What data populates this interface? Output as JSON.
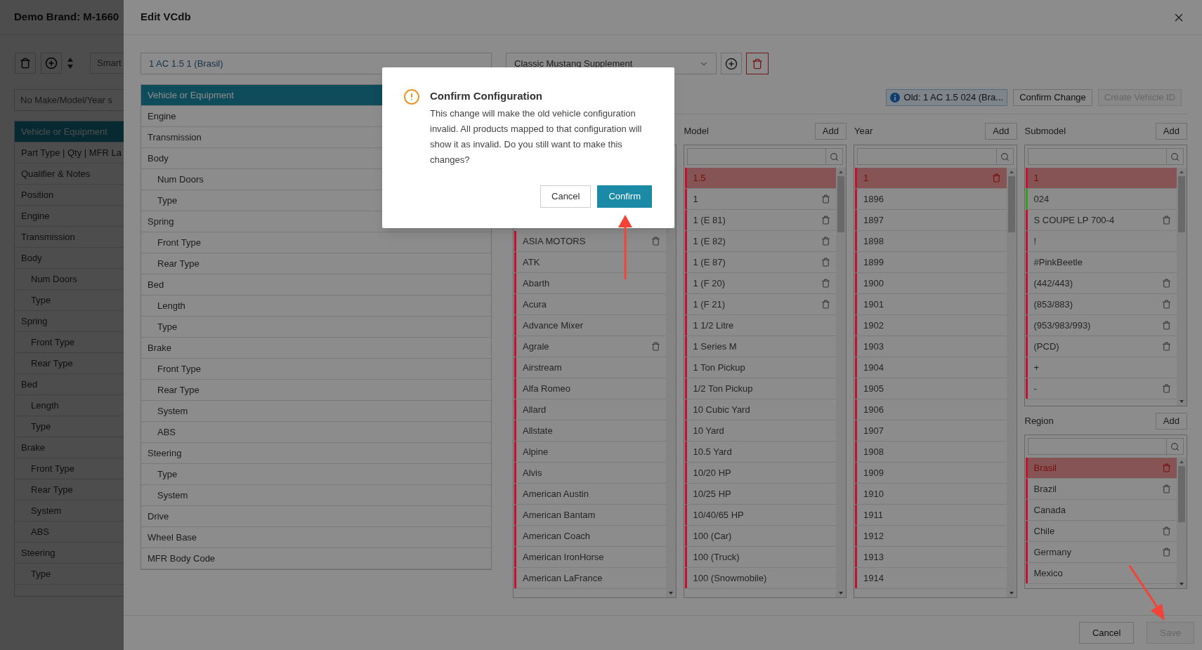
{
  "background_page": {
    "title": "Demo Brand: M-1660",
    "smart_placeholder": "Smart",
    "filter_placeholder": "No Make/Model/Year s",
    "nav": [
      {
        "label": "Vehicle or Equipment",
        "selected": true
      },
      {
        "label": "Part Type | Qty | MFR La",
        "selected": false
      },
      {
        "label": "Qualifier & Notes",
        "selected": false
      },
      {
        "label": "Position",
        "selected": false
      },
      {
        "label": "Engine",
        "selected": false
      },
      {
        "label": "Transmission",
        "selected": false
      },
      {
        "label": "Body",
        "selected": false,
        "children": [
          {
            "label": "Num Doors",
            "selected": false
          },
          {
            "label": "Type",
            "selected": false
          }
        ]
      },
      {
        "label": "Spring",
        "selected": false,
        "children": [
          {
            "label": "Front Type",
            "selected": false
          },
          {
            "label": "Rear Type",
            "selected": false
          }
        ]
      },
      {
        "label": "Bed",
        "selected": false,
        "children": [
          {
            "label": "Length",
            "selected": false
          },
          {
            "label": "Type",
            "selected": false
          }
        ]
      },
      {
        "label": "Brake",
        "selected": false,
        "children": [
          {
            "label": "Front Type",
            "selected": false
          },
          {
            "label": "Rear Type",
            "selected": false
          },
          {
            "label": "System",
            "selected": false
          },
          {
            "label": "ABS",
            "selected": false
          }
        ]
      },
      {
        "label": "Steering",
        "selected": false,
        "children": [
          {
            "label": "Type",
            "selected": false
          }
        ]
      }
    ]
  },
  "drawer": {
    "title": "Edit VCdb",
    "vehicle_field": "1 AC 1.5 1 (Brasil)",
    "tree": [
      {
        "label": "Vehicle or Equipment",
        "selected": true
      },
      {
        "label": "Engine",
        "selected": false
      },
      {
        "label": "Transmission",
        "selected": false
      },
      {
        "label": "Body",
        "selected": false,
        "children": [
          {
            "label": "Num Doors",
            "selected": false
          },
          {
            "label": "Type",
            "selected": false
          }
        ]
      },
      {
        "label": "Spring",
        "selected": false,
        "children": [
          {
            "label": "Front Type",
            "selected": false
          },
          {
            "label": "Rear Type",
            "selected": false
          }
        ]
      },
      {
        "label": "Bed",
        "selected": false,
        "children": [
          {
            "label": "Length",
            "selected": false
          },
          {
            "label": "Type",
            "selected": false
          }
        ]
      },
      {
        "label": "Brake",
        "selected": false,
        "children": [
          {
            "label": "Front Type",
            "selected": false
          },
          {
            "label": "Rear Type",
            "selected": false
          },
          {
            "label": "System",
            "selected": false
          },
          {
            "label": "ABS",
            "selected": false
          }
        ]
      },
      {
        "label": "Steering",
        "selected": false,
        "children": [
          {
            "label": "Type",
            "selected": false
          },
          {
            "label": "System",
            "selected": false
          }
        ]
      },
      {
        "label": "Drive",
        "selected": false
      },
      {
        "label": "Wheel Base",
        "selected": false
      },
      {
        "label": "MFR Body Code",
        "selected": false
      }
    ],
    "database_select": "Classic Mustang Supplement",
    "old_badge": "Old: 1 AC 1.5 024 (Bra...",
    "actions": [
      {
        "label": "Confirm Change",
        "disabled": false
      },
      {
        "label": "Create Vehicle ID",
        "disabled": true
      }
    ],
    "columns": [
      {
        "items": [
          {
            "label": "ASIA MOTORS",
            "selected": false,
            "color": "#c8102e",
            "deletable": true
          },
          {
            "label": "ATK",
            "selected": false,
            "color": "#c8102e",
            "deletable": false
          },
          {
            "label": "Abarth",
            "selected": false,
            "color": "#c8102e",
            "deletable": false
          },
          {
            "label": "Acura",
            "selected": false,
            "color": "#c8102e",
            "deletable": false
          },
          {
            "label": "Advance Mixer",
            "selected": false,
            "color": "#c8102e",
            "deletable": false
          },
          {
            "label": "Agrale",
            "selected": false,
            "color": "#c8102e",
            "deletable": true
          },
          {
            "label": "Airstream",
            "selected": false,
            "color": "#c8102e",
            "deletable": false
          },
          {
            "label": "Alfa Romeo",
            "selected": false,
            "color": "#c8102e",
            "deletable": false
          },
          {
            "label": "Allard",
            "selected": false,
            "color": "#c8102e",
            "deletable": false
          },
          {
            "label": "Allstate",
            "selected": false,
            "color": "#c8102e",
            "deletable": false
          },
          {
            "label": "Alpine",
            "selected": false,
            "color": "#c8102e",
            "deletable": false
          },
          {
            "label": "Alvis",
            "selected": false,
            "color": "#c8102e",
            "deletable": false
          },
          {
            "label": "American Austin",
            "selected": false,
            "color": "#c8102e",
            "deletable": false
          },
          {
            "label": "American Bantam",
            "selected": false,
            "color": "#c8102e",
            "deletable": false
          },
          {
            "label": "American Coach",
            "selected": false,
            "color": "#c8102e",
            "deletable": false
          },
          {
            "label": "American IronHorse",
            "selected": false,
            "color": "#c8102e",
            "deletable": false
          },
          {
            "label": "American LaFrance",
            "selected": false,
            "color": "#c8102e",
            "deletable": false
          }
        ]
      },
      {
        "title": "Model",
        "add_label": "Add",
        "items": [
          {
            "label": "1.5",
            "selected": true,
            "color": "#c8102e",
            "deletable": false
          },
          {
            "label": "1",
            "selected": false,
            "color": "#c8102e",
            "deletable": true
          },
          {
            "label": "1 (E 81)",
            "selected": false,
            "color": "#c8102e",
            "deletable": true
          },
          {
            "label": "1 (E 82)",
            "selected": false,
            "color": "#c8102e",
            "deletable": true
          },
          {
            "label": "1 (E 87)",
            "selected": false,
            "color": "#c8102e",
            "deletable": true
          },
          {
            "label": "1 (F 20)",
            "selected": false,
            "color": "#c8102e",
            "deletable": true
          },
          {
            "label": "1 (F 21)",
            "selected": false,
            "color": "#c8102e",
            "deletable": true
          },
          {
            "label": "1 1/2 Litre",
            "selected": false,
            "color": "#c8102e",
            "deletable": false
          },
          {
            "label": "1 Series M",
            "selected": false,
            "color": "#c8102e",
            "deletable": false
          },
          {
            "label": "1 Ton Pickup",
            "selected": false,
            "color": "#c8102e",
            "deletable": false
          },
          {
            "label": "1/2 Ton Pickup",
            "selected": false,
            "color": "#c8102e",
            "deletable": false
          },
          {
            "label": "10 Cubic Yard",
            "selected": false,
            "color": "#c8102e",
            "deletable": false
          },
          {
            "label": "10 Yard",
            "selected": false,
            "color": "#c8102e",
            "deletable": false
          },
          {
            "label": "10.5 Yard",
            "selected": false,
            "color": "#c8102e",
            "deletable": false
          },
          {
            "label": "10/20 HP",
            "selected": false,
            "color": "#c8102e",
            "deletable": false
          },
          {
            "label": "10/25 HP",
            "selected": false,
            "color": "#c8102e",
            "deletable": false
          },
          {
            "label": "10/40/65 HP",
            "selected": false,
            "color": "#c8102e",
            "deletable": false
          },
          {
            "label": "100 (Car)",
            "selected": false,
            "color": "#c8102e",
            "deletable": false
          },
          {
            "label": "100 (Truck)",
            "selected": false,
            "color": "#c8102e",
            "deletable": false
          },
          {
            "label": "100 (Snowmobile)",
            "selected": false,
            "color": "#c8102e",
            "deletable": false
          }
        ]
      },
      {
        "title": "Year",
        "add_label": "Add",
        "items": [
          {
            "label": "1",
            "selected": true,
            "color": "#c8102e",
            "deletable": true
          },
          {
            "label": "1896",
            "selected": false,
            "color": "#c8102e",
            "deletable": false
          },
          {
            "label": "1897",
            "selected": false,
            "color": "#c8102e",
            "deletable": false
          },
          {
            "label": "1898",
            "selected": false,
            "color": "#c8102e",
            "deletable": false
          },
          {
            "label": "1899",
            "selected": false,
            "color": "#c8102e",
            "deletable": false
          },
          {
            "label": "1900",
            "selected": false,
            "color": "#c8102e",
            "deletable": false
          },
          {
            "label": "1901",
            "selected": false,
            "color": "#c8102e",
            "deletable": false
          },
          {
            "label": "1902",
            "selected": false,
            "color": "#c8102e",
            "deletable": false
          },
          {
            "label": "1903",
            "selected": false,
            "color": "#c8102e",
            "deletable": false
          },
          {
            "label": "1904",
            "selected": false,
            "color": "#c8102e",
            "deletable": false
          },
          {
            "label": "1905",
            "selected": false,
            "color": "#c8102e",
            "deletable": false
          },
          {
            "label": "1906",
            "selected": false,
            "color": "#c8102e",
            "deletable": false
          },
          {
            "label": "1907",
            "selected": false,
            "color": "#c8102e",
            "deletable": false
          },
          {
            "label": "1908",
            "selected": false,
            "color": "#c8102e",
            "deletable": false
          },
          {
            "label": "1909",
            "selected": false,
            "color": "#c8102e",
            "deletable": false
          },
          {
            "label": "1910",
            "selected": false,
            "color": "#c8102e",
            "deletable": false
          },
          {
            "label": "1911",
            "selected": false,
            "color": "#c8102e",
            "deletable": false
          },
          {
            "label": "1912",
            "selected": false,
            "color": "#c8102e",
            "deletable": false
          },
          {
            "label": "1913",
            "selected": false,
            "color": "#c8102e",
            "deletable": false
          },
          {
            "label": "1914",
            "selected": false,
            "color": "#c8102e",
            "deletable": false
          }
        ]
      },
      {
        "title": "Submodel",
        "add_label": "Add",
        "items": [
          {
            "label": "1",
            "selected": true,
            "color": "#c8102e",
            "deletable": false
          },
          {
            "label": "024",
            "selected": false,
            "color": "#3a9d23",
            "deletable": false
          },
          {
            "label": "S COUPE LP 700-4",
            "selected": false,
            "color": "#c8102e",
            "deletable": true
          },
          {
            "label": "!",
            "selected": false,
            "color": "#c8102e",
            "deletable": false
          },
          {
            "label": "#PinkBeetle",
            "selected": false,
            "color": "#c8102e",
            "deletable": false
          },
          {
            "label": "(442/443)",
            "selected": false,
            "color": "#c8102e",
            "deletable": true
          },
          {
            "label": "(853/883)",
            "selected": false,
            "color": "#c8102e",
            "deletable": true
          },
          {
            "label": "(953/983/993)",
            "selected": false,
            "color": "#c8102e",
            "deletable": true
          },
          {
            "label": "(PCD)",
            "selected": false,
            "color": "#c8102e",
            "deletable": true
          },
          {
            "label": "+",
            "selected": false,
            "color": "#c8102e",
            "deletable": false
          },
          {
            "label": "-",
            "selected": false,
            "color": "#c8102e",
            "deletable": true
          }
        ]
      }
    ],
    "region": {
      "title": "Region",
      "add_label": "Add",
      "items": [
        {
          "label": "Brasil",
          "selected": true,
          "color": "#c8102e",
          "deletable": true
        },
        {
          "label": "Brazil",
          "selected": false,
          "color": "#c8102e",
          "deletable": true
        },
        {
          "label": "Canada",
          "selected": false,
          "color": "#c8102e",
          "deletable": false
        },
        {
          "label": "Chile",
          "selected": false,
          "color": "#c8102e",
          "deletable": true
        },
        {
          "label": "Germany",
          "selected": false,
          "color": "#c8102e",
          "deletable": true
        },
        {
          "label": "Mexico",
          "selected": false,
          "color": "#c8102e",
          "deletable": false
        }
      ]
    },
    "footer_buttons": [
      {
        "label": "Cancel",
        "disabled": false
      },
      {
        "label": "Save",
        "disabled": true
      }
    ]
  },
  "dialog": {
    "title": "Confirm Configuration",
    "message": "This change will make the old vehicle configuration invalid. All products mapped to that configuration will show it as invalid. Do you still want to make this changes?",
    "buttons": [
      {
        "label": "Cancel",
        "kind": "secondary"
      },
      {
        "label": "Confirm",
        "kind": "primary"
      }
    ]
  }
}
